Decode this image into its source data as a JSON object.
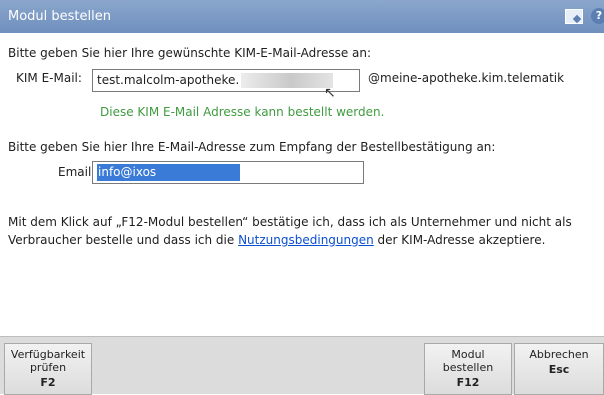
{
  "window": {
    "title": "Modul bestellen",
    "icons": [
      "window-icon",
      "help-icon"
    ]
  },
  "kim": {
    "prompt": "Bitte geben Sie hier Ihre gewünschte KIM-E-Mail-Adresse an:",
    "label": "KIM E-Mail:",
    "value": "test.malcolm-apotheke.",
    "domain": "@meine-apotheke.kim.telematik",
    "status": "Diese KIM E-Mail Adresse kann bestellt werden."
  },
  "confirm": {
    "prompt": "Bitte geben Sie hier Ihre E-Mail-Adresse zum Empfang der Bestellbestätigung an:",
    "label": "Email:",
    "value": "info@ixos"
  },
  "terms": {
    "line1": "Mit dem Klick auf „F12-Modul bestellen“ bestätige ich, dass ich als Unternehmer und nicht als",
    "line2_pre": "Verbraucher bestelle und dass ich die ",
    "link": "Nutzungsbedingungen",
    "line2_post": " der KIM-Adresse akzeptiere."
  },
  "buttons": [
    {
      "line1": "Verfügbarkeit",
      "line2": "prüfen",
      "key": "F2"
    },
    {
      "line1": "Modul",
      "line2": "bestellen",
      "key": "F12"
    },
    {
      "line1": "Abbrechen",
      "line2": "",
      "key": "Esc"
    }
  ],
  "colors": {
    "titlebar": "#7b98c4",
    "status_ok": "#3f9b3f",
    "link": "#0b4fd1",
    "selection": "#3a7bd8"
  }
}
